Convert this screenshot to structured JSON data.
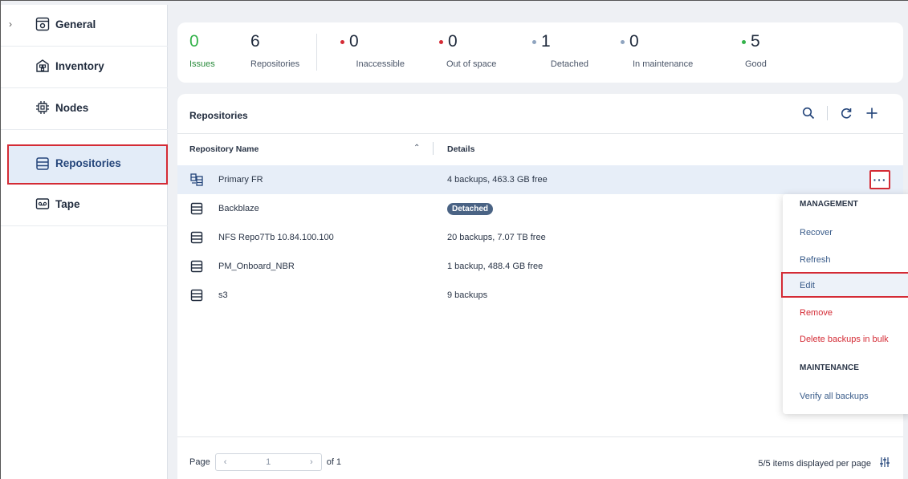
{
  "sidebar": {
    "items": [
      {
        "label": "General",
        "icon": "gear-icon",
        "expandable": true
      },
      {
        "label": "Inventory",
        "icon": "inventory-icon"
      },
      {
        "label": "Nodes",
        "icon": "chip-icon"
      },
      {
        "label": "Repositories",
        "icon": "repository-icon",
        "active": true
      },
      {
        "label": "Tape",
        "icon": "tape-icon"
      }
    ]
  },
  "stats": {
    "issues": {
      "value": "0",
      "label": "Issues"
    },
    "repositories": {
      "value": "6",
      "label": "Repositories"
    },
    "inaccessible": {
      "value": "0",
      "label": "Inaccessible",
      "color": "#d42b35"
    },
    "out_of_space": {
      "value": "0",
      "label": "Out of space",
      "color": "#d42b35"
    },
    "detached": {
      "value": "1",
      "label": "Detached",
      "color": "#8fa4bf"
    },
    "maintenance": {
      "value": "0",
      "label": "In maintenance",
      "color": "#8fa4bf"
    },
    "good": {
      "value": "5",
      "label": "Good",
      "color": "#33b24a"
    }
  },
  "repos": {
    "title": "Repositories",
    "col_name": "Repository Name",
    "col_details": "Details",
    "rows": [
      {
        "name": "Primary FR",
        "details": "4 backups, 463.3 GB free",
        "icon": "repository-group-icon",
        "selected": true
      },
      {
        "name": "Backblaze",
        "badge": "Detached",
        "icon": "repository-icon"
      },
      {
        "name": "NFS Repo7Tb 10.84.100.100",
        "details": "20 backups, 7.07 TB free",
        "icon": "repository-icon"
      },
      {
        "name": "PM_Onboard_NBR",
        "details": "1 backup, 488.4 GB free",
        "icon": "repository-icon"
      },
      {
        "name": "s3",
        "details": "9 backups",
        "icon": "repository-icon"
      }
    ],
    "more_label": "···"
  },
  "pager": {
    "page_label": "Page",
    "page_value": "1",
    "of_label": "of 1",
    "per_page": "5/5 items displayed per page"
  },
  "menu": {
    "management_header": "MANAGEMENT",
    "recover": "Recover",
    "refresh": "Refresh",
    "edit": "Edit",
    "remove": "Remove",
    "delete_bulk": "Delete backups in bulk",
    "maintenance_header": "MAINTENANCE",
    "verify": "Verify all backups"
  },
  "colors": {
    "accent": "#24457a",
    "highlight": "#d42b35",
    "good": "#33b24a"
  }
}
